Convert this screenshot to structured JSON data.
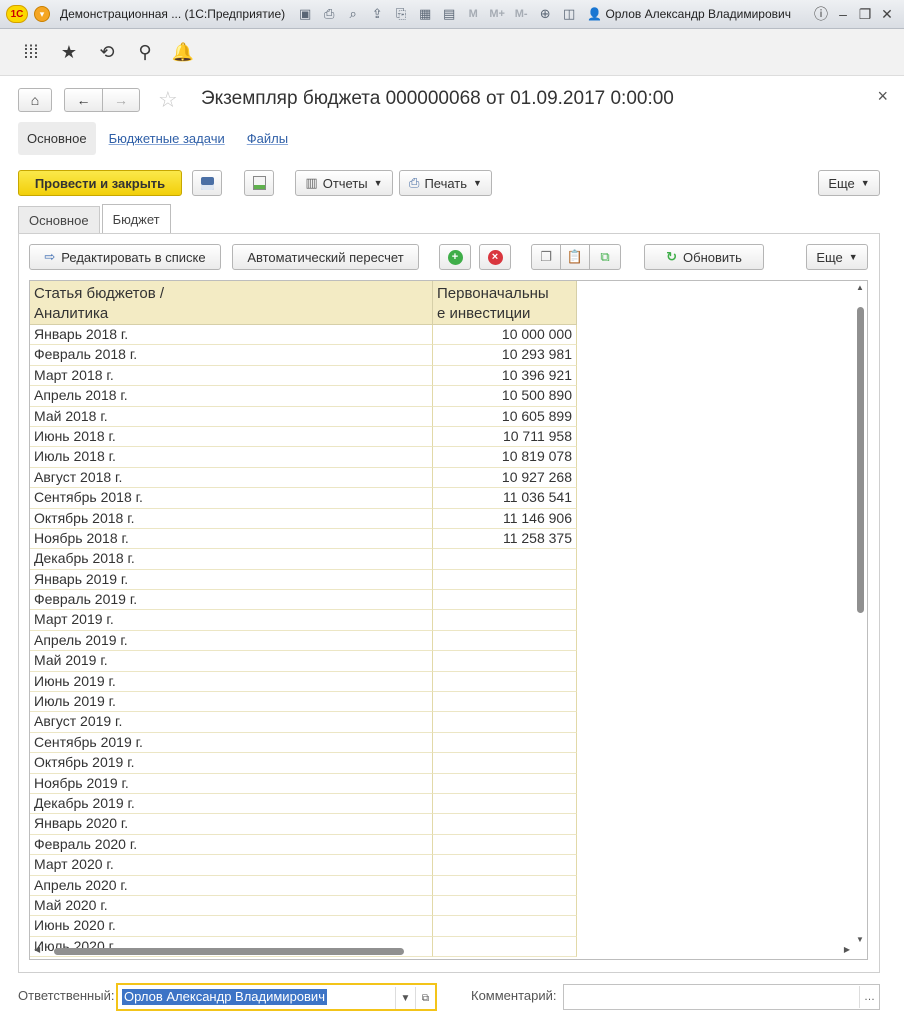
{
  "titlebar": {
    "logo": "1С",
    "title": "Демонстрационная ...  (1С:Предприятие)",
    "mode_labels": [
      "M",
      "M+",
      "M-"
    ],
    "user": "Орлов Александр Владимирович",
    "icons": [
      "save-icon",
      "print-icon",
      "preview-icon",
      "upload-icon",
      "attach-icon",
      "calculator-icon",
      "calendar-icon",
      "zoom-icon",
      "panel-icon",
      "info-icon",
      "minimize-icon",
      "restore-icon",
      "close-icon"
    ]
  },
  "sections": {
    "icons": [
      "apps-grid-icon",
      "favorites-star-icon",
      "history-icon",
      "search-icon",
      "bell-icon"
    ]
  },
  "form": {
    "title": "Экземпляр бюджета 000000068 от 01.09.2017 0:00:00",
    "close": "×",
    "nav": {
      "home": "⌂",
      "back": "←",
      "forward": "→",
      "star": "☆"
    },
    "links": [
      {
        "label": "Основное",
        "active": true
      },
      {
        "label": "Бюджетные задачи",
        "active": false
      },
      {
        "label": "Файлы",
        "active": false
      }
    ],
    "commands": {
      "post_close": "Провести и закрыть",
      "reports": "Отчеты",
      "print": "Печать",
      "more": "Еще"
    },
    "tabs": [
      {
        "label": "Основное",
        "active": false
      },
      {
        "label": "Бюджет",
        "active": true
      }
    ],
    "panel": {
      "edit_list": "Редактировать в списке",
      "auto_recalc": "Автоматический пересчет",
      "refresh": "Обновить",
      "more": "Еще",
      "add_symbol": "+",
      "delete_symbol": "×",
      "refresh_symbol": "↻"
    },
    "table": {
      "headers": [
        "Статья бюджетов / Аналитика",
        "Первоначальные инвестиции"
      ],
      "header_lines": [
        [
          "Статья бюджетов /",
          "Аналитика"
        ],
        [
          "Первоначальны",
          "е инвестиции"
        ]
      ],
      "rows": [
        [
          "Январь 2018 г.",
          "10 000 000"
        ],
        [
          "Февраль 2018 г.",
          "10 293 981"
        ],
        [
          "Март 2018 г.",
          "10 396 921"
        ],
        [
          "Апрель 2018 г.",
          "10 500 890"
        ],
        [
          "Май 2018 г.",
          "10 605 899"
        ],
        [
          "Июнь 2018 г.",
          "10 711 958"
        ],
        [
          "Июль 2018 г.",
          "10 819 078"
        ],
        [
          "Август 2018 г.",
          "10 927 268"
        ],
        [
          "Сентябрь 2018 г.",
          "11 036 541"
        ],
        [
          "Октябрь 2018 г.",
          "11 146 906"
        ],
        [
          "Ноябрь 2018 г.",
          "11 258 375"
        ],
        [
          "Декабрь 2018 г.",
          ""
        ],
        [
          "Январь 2019 г.",
          ""
        ],
        [
          "Февраль 2019 г.",
          ""
        ],
        [
          "Март 2019 г.",
          ""
        ],
        [
          "Апрель 2019 г.",
          ""
        ],
        [
          "Май 2019 г.",
          ""
        ],
        [
          "Июнь 2019 г.",
          ""
        ],
        [
          "Июль 2019 г.",
          ""
        ],
        [
          "Август 2019 г.",
          ""
        ],
        [
          "Сентябрь 2019 г.",
          ""
        ],
        [
          "Октябрь 2019 г.",
          ""
        ],
        [
          "Ноябрь 2019 г.",
          ""
        ],
        [
          "Декабрь 2019 г.",
          ""
        ],
        [
          "Январь 2020 г.",
          ""
        ],
        [
          "Февраль 2020 г.",
          ""
        ],
        [
          "Март 2020 г.",
          ""
        ],
        [
          "Апрель 2020 г.",
          ""
        ],
        [
          "Май 2020 г.",
          ""
        ],
        [
          "Июнь 2020 г.",
          ""
        ],
        [
          "Июль 2020 г.",
          ""
        ]
      ]
    },
    "footer": {
      "responsible_label": "Ответственный:",
      "responsible_value": "Орлов Александр Владимирович",
      "comment_label": "Комментарий:",
      "comment_value": ""
    }
  },
  "colors": {
    "primary_button": "#f2cf0a",
    "table_header": "#f3ebc4",
    "link": "#2f5fa7",
    "selection": "#3d74c6",
    "focus_border": "#f3c419"
  }
}
